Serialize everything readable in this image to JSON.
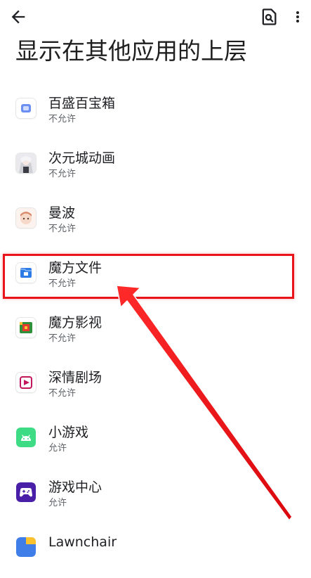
{
  "header": {
    "title": "显示在其他应用的上层",
    "back_icon": "arrow-back-icon",
    "search_icon": "search-in-page-icon",
    "more_icon": "more-vert-icon"
  },
  "apps": [
    {
      "name": "百盛百宝箱",
      "status": "不允许",
      "icon": "toolbox-app-icon"
    },
    {
      "name": "次元城动画",
      "status": "不允许",
      "icon": "anime-app-icon"
    },
    {
      "name": "曼波",
      "status": "不允许",
      "icon": "manbo-app-icon"
    },
    {
      "name": "魔方文件",
      "status": "不允许",
      "icon": "file-manager-app-icon"
    },
    {
      "name": "魔方影视",
      "status": "不允许",
      "icon": "video-app-icon"
    },
    {
      "name": "深情剧场",
      "status": "不允许",
      "icon": "theater-app-icon"
    },
    {
      "name": "小游戏",
      "status": "允许",
      "icon": "android-app-icon"
    },
    {
      "name": "游戏中心",
      "status": "允许",
      "icon": "gamepad-app-icon"
    },
    {
      "name": "Lawnchair",
      "status": "",
      "icon": "lawnchair-app-icon"
    }
  ],
  "annotation": {
    "highlight_color": "#e8141a"
  }
}
